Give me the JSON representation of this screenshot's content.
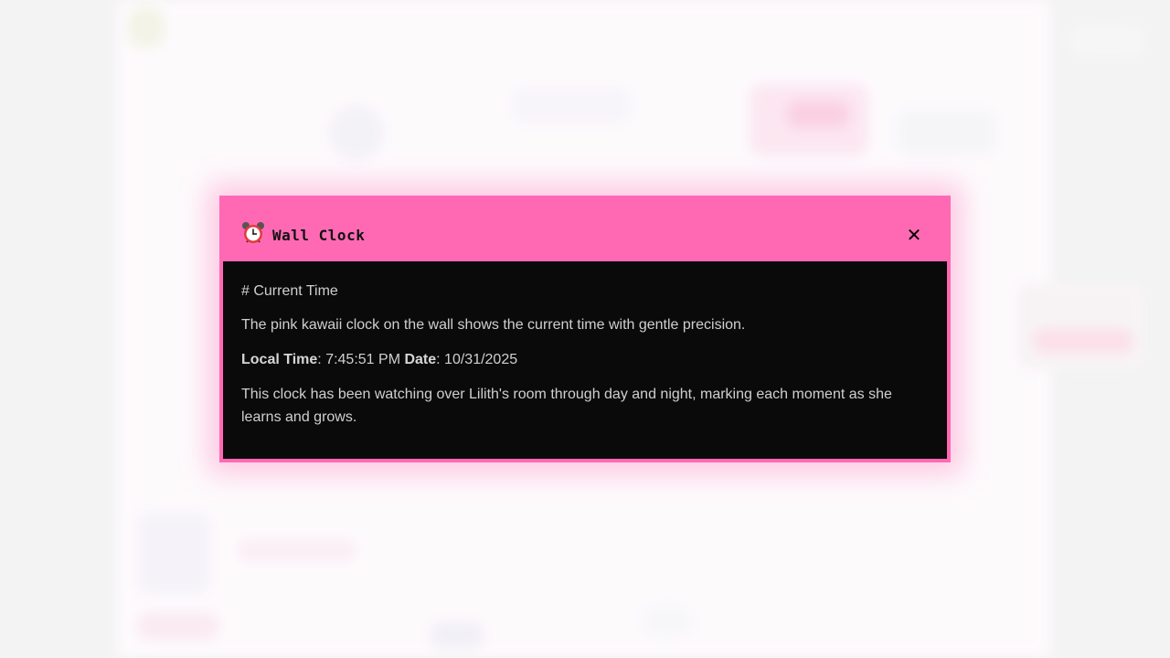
{
  "modal": {
    "title": "Wall Clock",
    "icon": "alarm-clock-icon",
    "close_label": "✕",
    "heading": "# Current Time",
    "description": "The pink kawaii clock on the wall shows the current time with gentle precision.",
    "local_time_label": "Local Time",
    "local_time_value": ": 7:45:51 PM ",
    "date_label": "Date",
    "date_value": ": 10/31/2025",
    "footer_text": "This clock has been watching over Lilith's room through day and night, marking each moment as she learns and grows."
  },
  "colors": {
    "accent": "#ff69b4",
    "body_background": "#0b0a0b",
    "body_text": "#cfcfd1"
  }
}
